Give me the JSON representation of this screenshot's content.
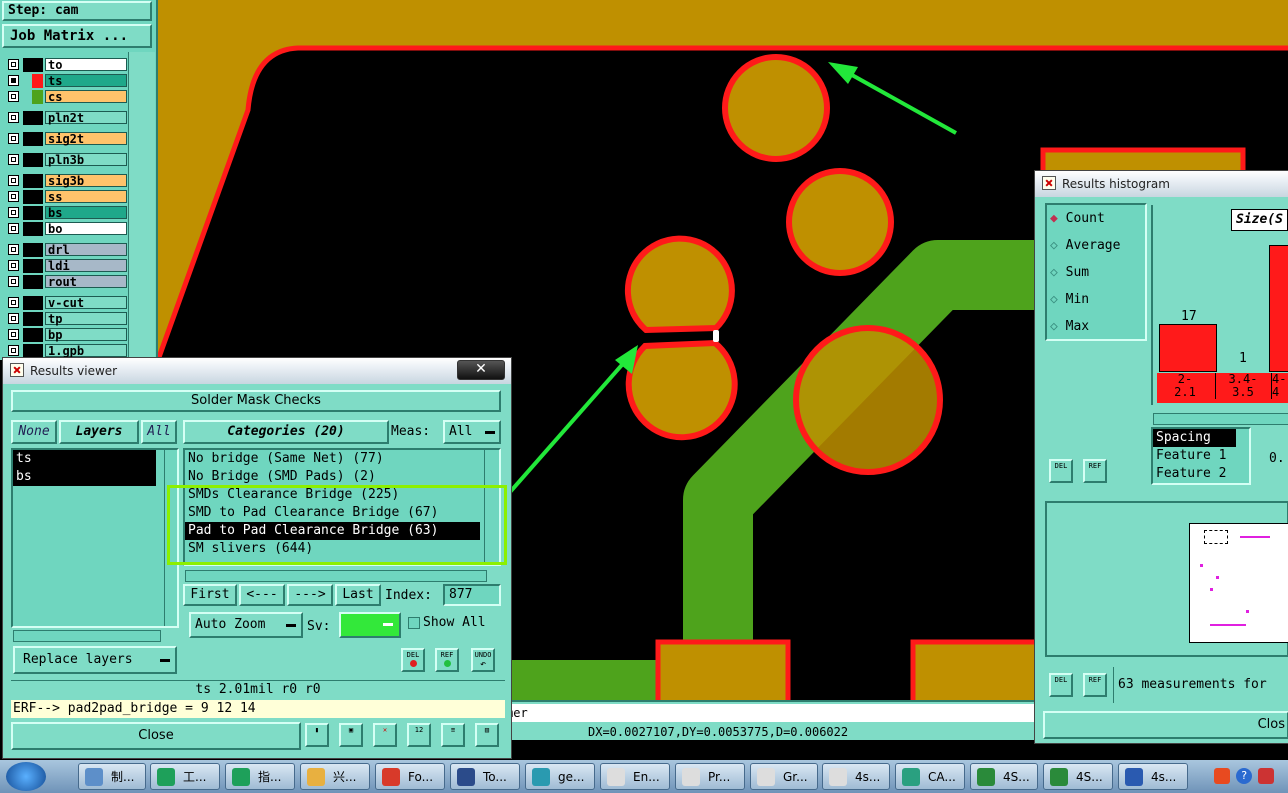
{
  "left_panel": {
    "step_label": "Step: cam",
    "job_matrix_button": "Job Matrix ...",
    "layers": [
      {
        "name": "to",
        "color": "#ffffff"
      },
      {
        "name": "ts",
        "color": "#1fa88a"
      },
      {
        "name": "cs",
        "color": "#ffc36b"
      },
      {
        "name": "pln2t",
        "color": "#7fdcc6"
      },
      {
        "name": "sig2t",
        "color": "#ffc36b"
      },
      {
        "name": "pln3b",
        "color": "#7fdcc6"
      },
      {
        "name": "sig3b",
        "color": "#ffc36b"
      },
      {
        "name": "ss",
        "color": "#ffc36b"
      },
      {
        "name": "bs",
        "color": "#1fa88a"
      },
      {
        "name": "bo",
        "color": "#ffffff"
      },
      {
        "name": "drl",
        "color": "#a7b8c8"
      },
      {
        "name": "ldi",
        "color": "#a7b8c8"
      },
      {
        "name": "rout",
        "color": "#a7b8c8"
      },
      {
        "name": "v-cut",
        "color": "#7fdcc6"
      },
      {
        "name": "tp",
        "color": "#7fdcc6"
      },
      {
        "name": "bp",
        "color": "#7fdcc6"
      },
      {
        "name": "1.gpb",
        "color": "#7fdcc6"
      }
    ]
  },
  "results_viewer": {
    "title": "Results viewer",
    "header": "Solder Mask Checks",
    "none_button": "None",
    "layers_button": "Layers",
    "all_button": "All",
    "categories_button": "Categories (20)",
    "meas_label": "Meas:",
    "meas_value": "All",
    "layer_list": [
      "ts",
      "bs"
    ],
    "categories": [
      "No bridge (Same Net) (77)",
      "No Bridge (SMD Pads) (2)",
      "SMDs Clearance Bridge (225)",
      "SMD to Pad Clearance Bridge (67)",
      "Pad to Pad Clearance Bridge (63)",
      "SM slivers (644)"
    ],
    "selected_category": "Pad to Pad Clearance Bridge (63)",
    "first_button": "First",
    "prev_button": "<---",
    "next_button": "--->",
    "last_button": "Last",
    "index_label": "Index:",
    "index_value": "877",
    "auto_zoom_label": "Auto Zoom",
    "sv_label": "Sv:",
    "sv_color": "#33e83a",
    "show_all_label": "Show All",
    "replace_layers_label": "Replace layers",
    "del_label": "DEL",
    "ref_label": "REF",
    "undo_label": "UNDO",
    "status_line": "ts 2.01mil  r0  r0",
    "erf_line": "ERF--> pad2pad_bridge = 9 12 14",
    "close_label": "Close"
  },
  "histogram": {
    "title": "Results histogram",
    "options": [
      "Count",
      "Average",
      "Sum",
      "Min",
      "Max"
    ],
    "selected_option": "Count",
    "chart_title": "Size(S",
    "bar_labels": [
      "17",
      "1"
    ],
    "bins": [
      "2-\n2.1",
      "3.4-\n3.5",
      "4-\n4"
    ],
    "fields": [
      "Spacing",
      "Feature 1",
      "Feature 2"
    ],
    "field_value": "0.",
    "measurements_text": "63 measurements for",
    "close_label": "Clos",
    "del_label": "DEL",
    "ref_label": "REF"
  },
  "canvas": {
    "coord_readout": "DX=0.0027107,DY=0.0053775,D=0.006022",
    "viewer_tail": "mer"
  },
  "taskbar": {
    "items": [
      {
        "label": "制...",
        "color": "#5d8fc9"
      },
      {
        "label": "工...",
        "color": "#1ea05a"
      },
      {
        "label": "指...",
        "color": "#1ea05a"
      },
      {
        "label": "兴...",
        "color": "#e8b040"
      },
      {
        "label": "Fo...",
        "color": "#d83a2a"
      },
      {
        "label": "To...",
        "color": "#2b4b8a"
      },
      {
        "label": "ge...",
        "color": "#2a9ab0"
      },
      {
        "label": "En...",
        "color": "#ddd"
      },
      {
        "label": "Pr...",
        "color": "#ddd"
      },
      {
        "label": "Gr...",
        "color": "#ddd"
      },
      {
        "label": "4s...",
        "color": "#ddd"
      },
      {
        "label": "CA...",
        "color": "#2aa080"
      },
      {
        "label": "4S...",
        "color": "#2a8a3a"
      },
      {
        "label": "4S...",
        "color": "#2a8a3a"
      },
      {
        "label": "4s...",
        "color": "#2a5ab0"
      }
    ]
  }
}
